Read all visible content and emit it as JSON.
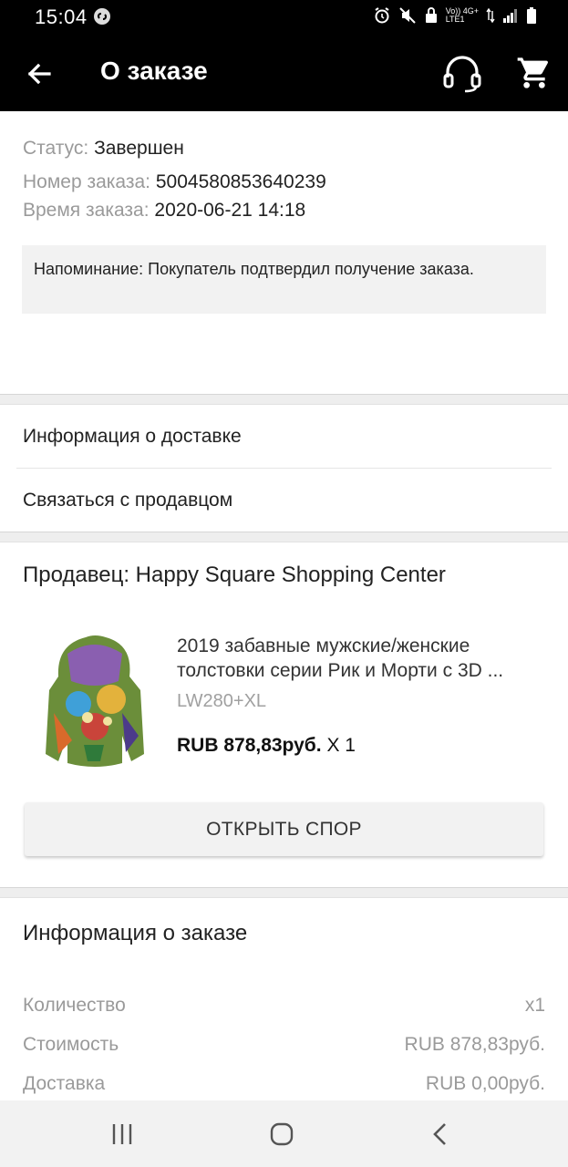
{
  "status_bar": {
    "time": "15:04",
    "network_line1": "Vo)) 4G+",
    "network_line2": "LTE1"
  },
  "app_bar": {
    "title": "О заказе",
    "icons": [
      "back-arrow-icon",
      "headset-support-icon",
      "cart-icon"
    ]
  },
  "order_summary": {
    "status_label": "Статус:",
    "status_value": "Завершен",
    "number_label": "Номер заказа:",
    "number_value": "5004580853640239",
    "time_label": "Время заказа:",
    "time_value": "2020-06-21 14:18",
    "reminder": "Напоминание: Покупатель подтвердил получение заказа."
  },
  "links": {
    "delivery_info": "Информация о доставке",
    "contact_seller": "Связаться с продавцом"
  },
  "seller": {
    "title": "Продавец: Happy Square Shopping Center",
    "product": {
      "name": "2019 забавные мужские/женские толстовки серии Рик и Морти с 3D ...",
      "variant": "LW280+XL",
      "price": "RUB 878,83руб.",
      "quantity": "X 1"
    },
    "dispute_button": "ОТКРЫТЬ СПОР"
  },
  "order_info": {
    "title": "Информация о заказе",
    "rows": [
      {
        "label": "Количество",
        "value": "x1"
      },
      {
        "label": "Стоимость",
        "value": "RUB 878,83руб."
      },
      {
        "label": "Доставка",
        "value": "RUB 0,00руб."
      }
    ]
  },
  "colors": {
    "bar_background": "#000000",
    "label_gray": "#9a9a9a",
    "reminder_bg": "#f2f2f2"
  }
}
